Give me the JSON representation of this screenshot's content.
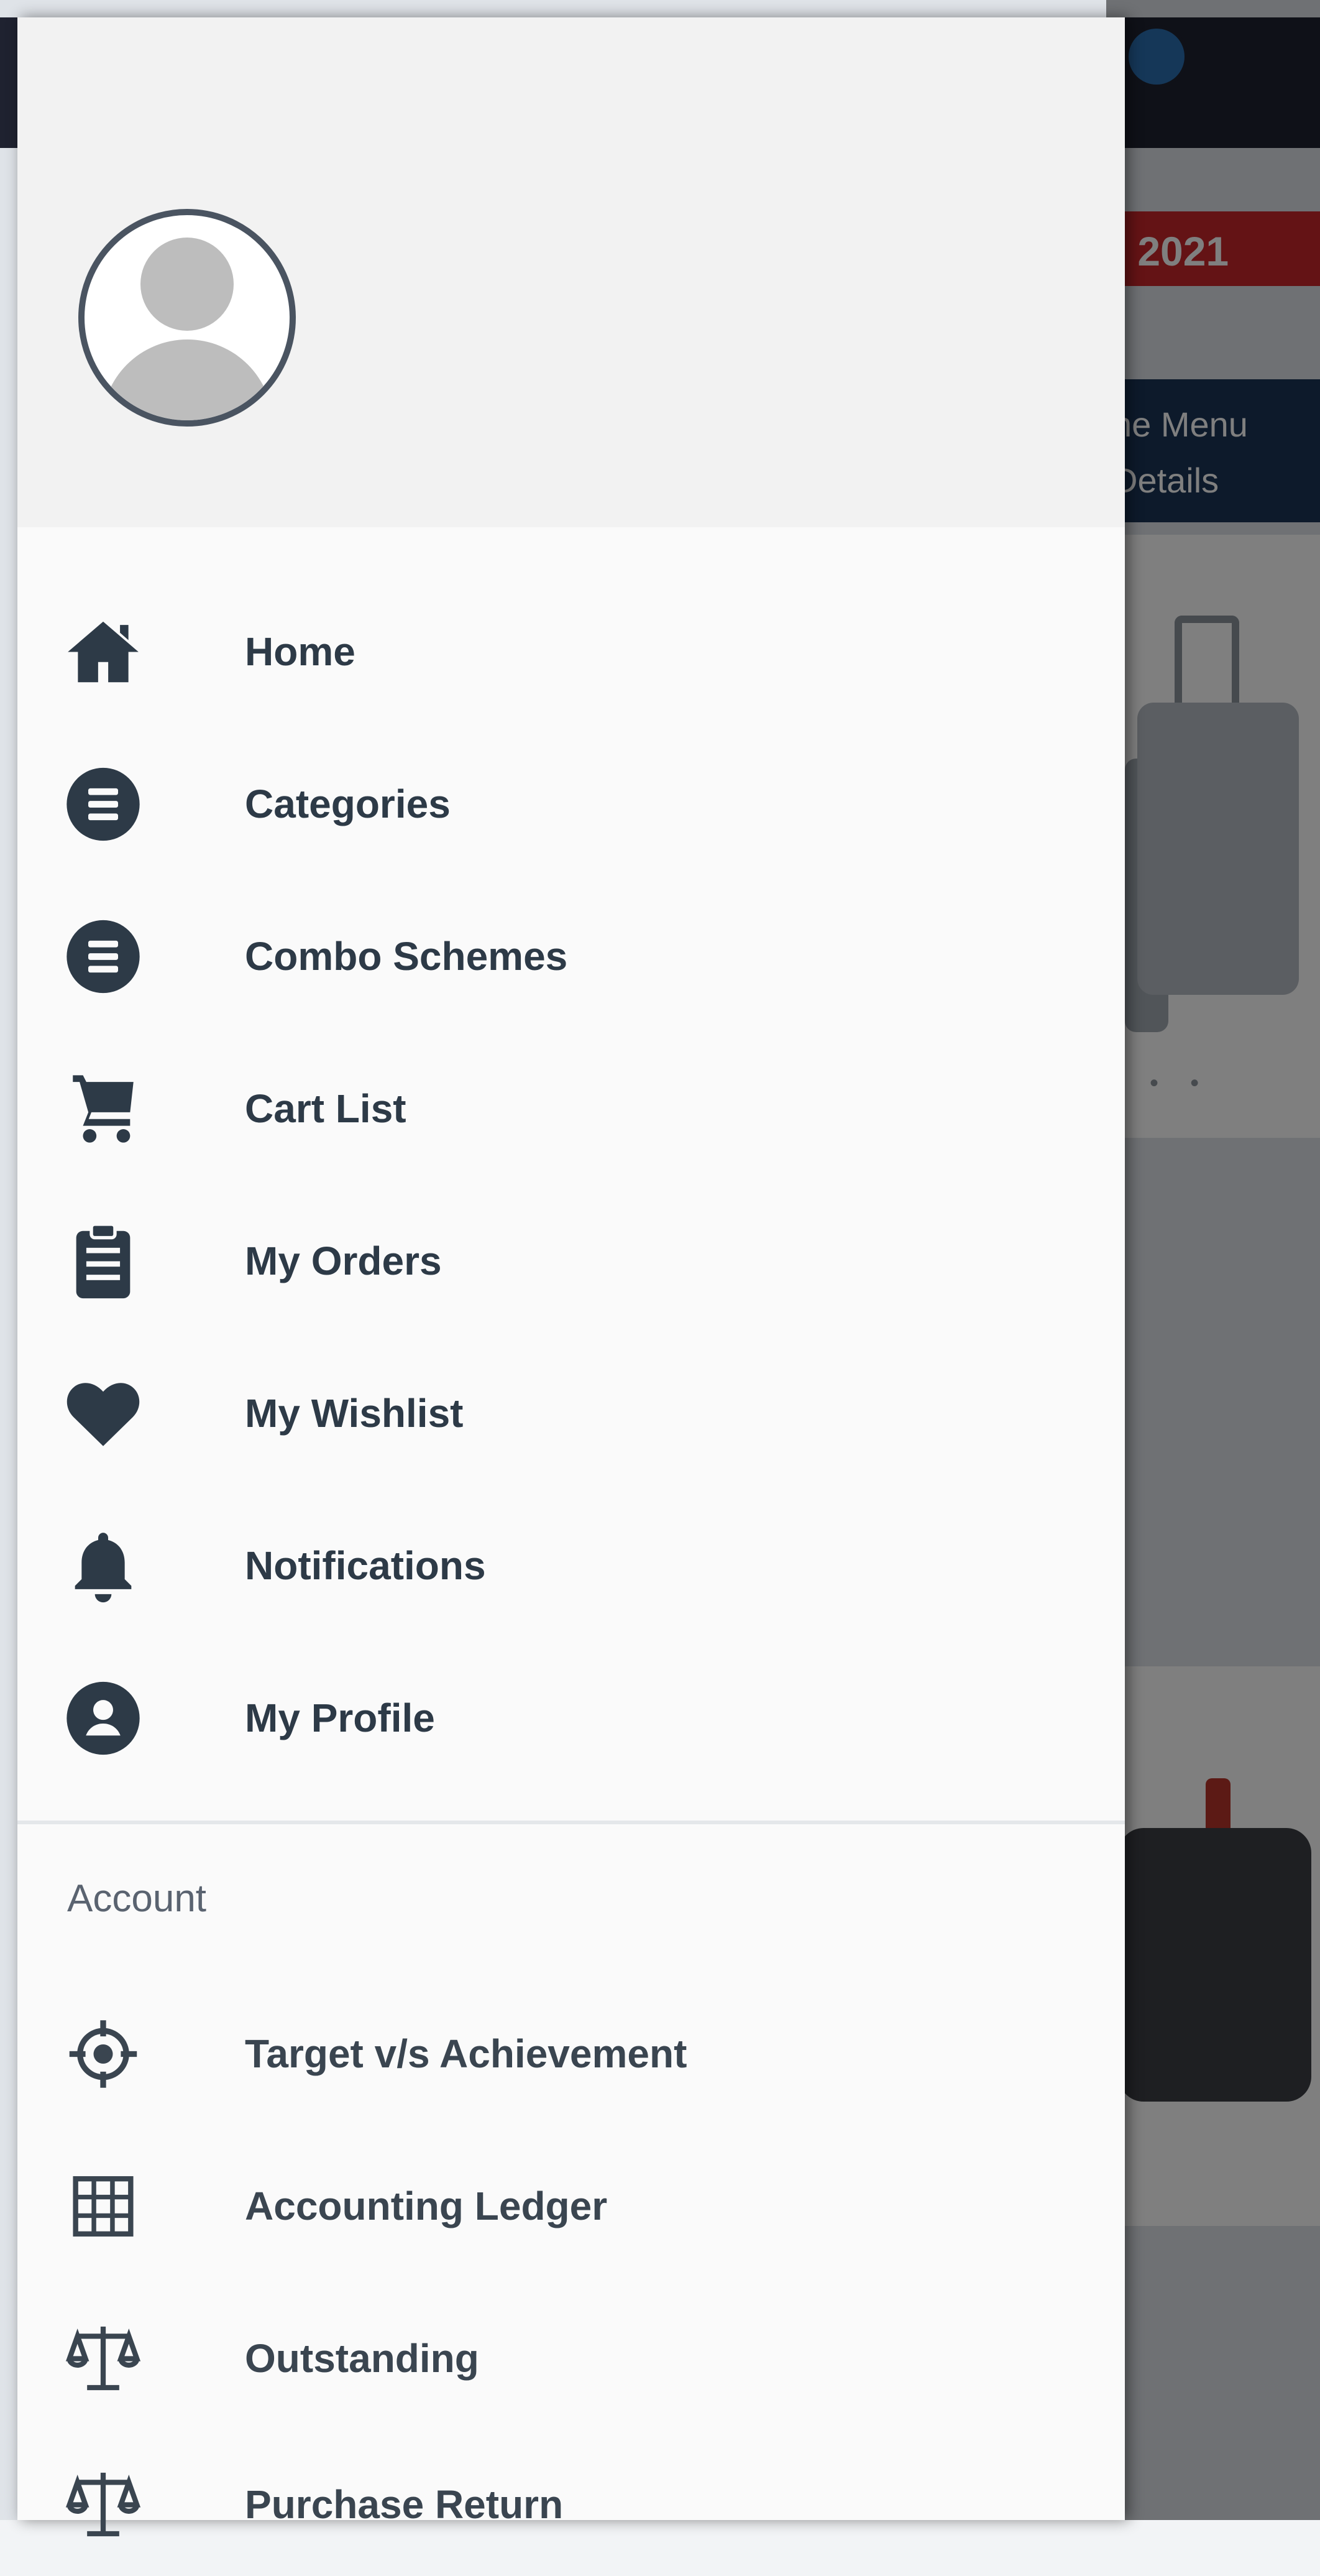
{
  "background": {
    "banner_text": ": 2021",
    "menu_card_line1": "he Menu",
    "menu_card_line2": "Details"
  },
  "drawer": {
    "menu_items": [
      {
        "label": "Home",
        "icon": "home-icon"
      },
      {
        "label": "Categories",
        "icon": "list-circle-icon"
      },
      {
        "label": "Combo Schemes",
        "icon": "list-circle-icon"
      },
      {
        "label": "Cart List",
        "icon": "cart-icon"
      },
      {
        "label": "My Orders",
        "icon": "clipboard-icon"
      },
      {
        "label": "My Wishlist",
        "icon": "heart-icon"
      },
      {
        "label": "Notifications",
        "icon": "bell-icon"
      },
      {
        "label": "My Profile",
        "icon": "profile-circle-icon"
      }
    ],
    "section_title": "Account",
    "account_items": [
      {
        "label": "Target v/s Achievement",
        "icon": "target-icon"
      },
      {
        "label": "Accounting Ledger",
        "icon": "grid-icon"
      },
      {
        "label": "Outstanding",
        "icon": "scale-icon"
      },
      {
        "label": "Purchase Return",
        "icon": "scale-icon"
      }
    ]
  },
  "colors": {
    "icon": "#2d3a47",
    "drawer_bg": "#fafafa",
    "header_bg": "#f2f2f2"
  }
}
